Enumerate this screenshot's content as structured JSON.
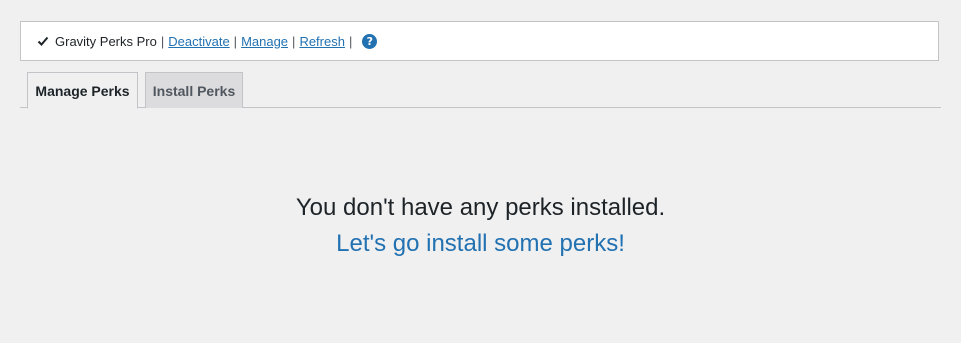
{
  "license_bar": {
    "product_name": "Gravity Perks Pro",
    "separator": "|",
    "deactivate_label": "Deactivate",
    "manage_label": "Manage",
    "refresh_label": "Refresh",
    "help_icon_glyph": "?",
    "status_icon": "check-icon"
  },
  "tabs": [
    {
      "label": "Manage Perks",
      "active": true
    },
    {
      "label": "Install Perks",
      "active": false
    }
  ],
  "empty_state": {
    "message": "You don't have any perks installed.",
    "link_label": "Let's go install some perks!"
  },
  "colors": {
    "background": "#f0f0f1",
    "link": "#2271b1",
    "inactive_tab": "#dcdcde"
  }
}
